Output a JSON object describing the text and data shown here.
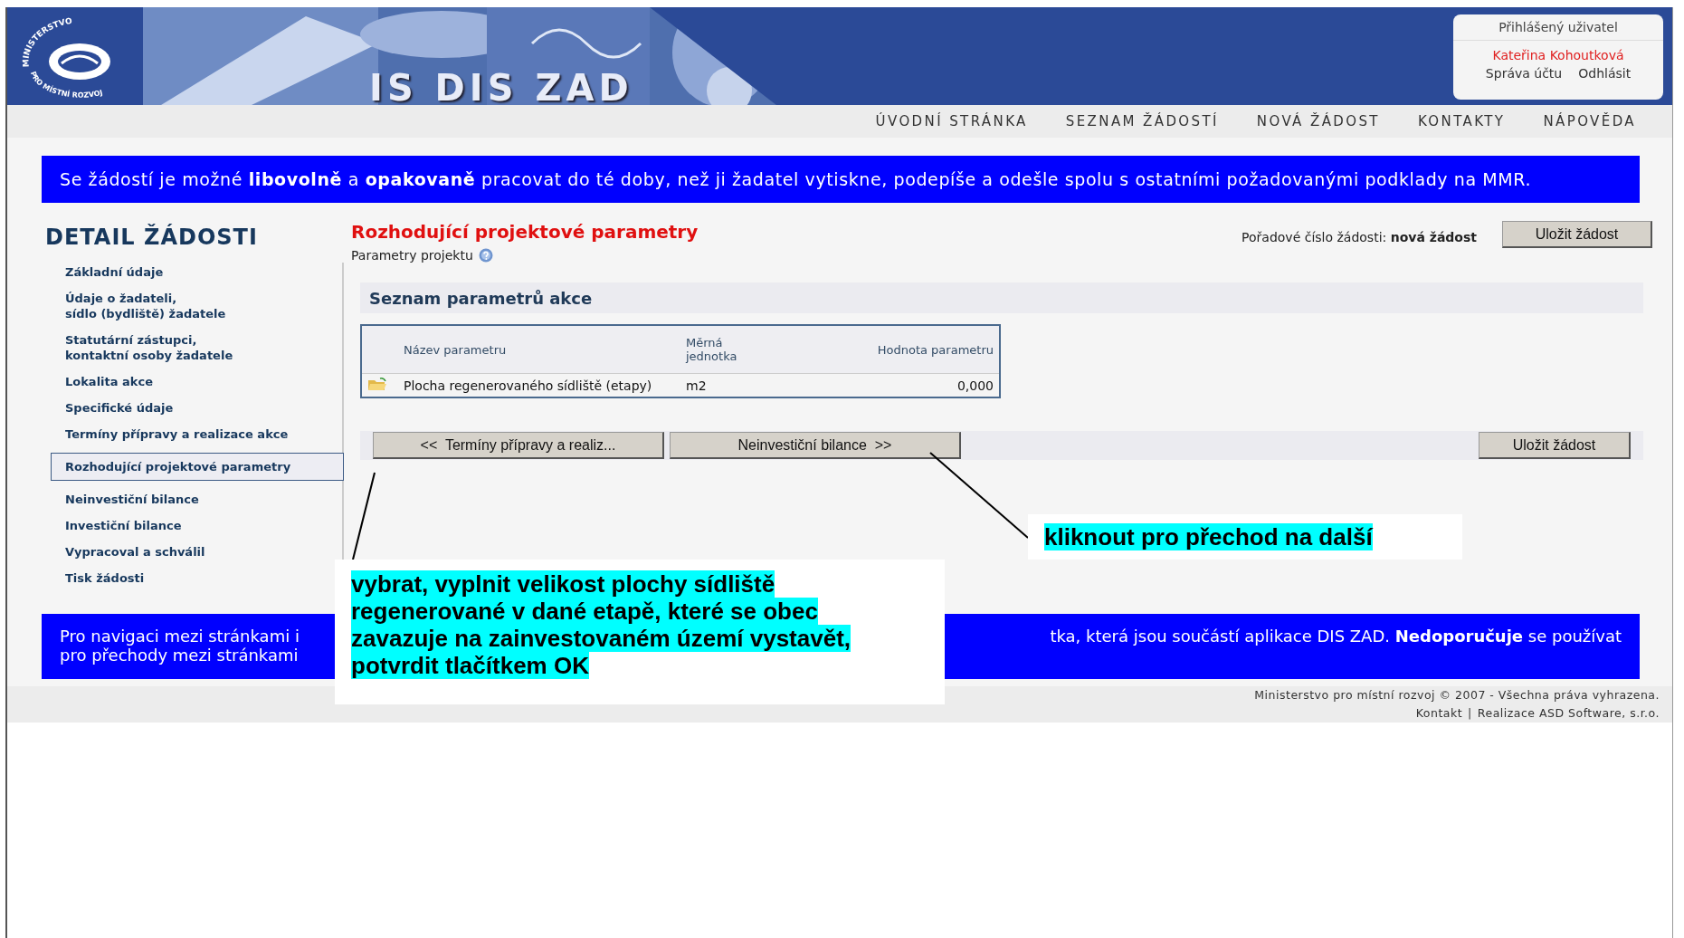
{
  "header": {
    "logo_top": "MINISTERSTVO",
    "logo_bottom": "PRO MÍSTNÍ ROZVOJ",
    "app_title": "IS DIS ZAD",
    "user_box": {
      "heading": "Přihlášený uživatel",
      "name": "Kateřina Kohoutková",
      "links": [
        "Správa účtu",
        "Odhlásit"
      ]
    }
  },
  "nav": [
    "ÚVODNÍ STRÁNKA",
    "SEZNAM ŽÁDOSTÍ",
    "NOVÁ ŽÁDOST",
    "KONTAKTY",
    "NÁPOVĚDA"
  ],
  "notice": "Se žádostí je možné **libovolně** a **opakovaně** pracovat do té doby, než ji žadatel vytiskne, podepíše a odešle spolu s ostatními požadovanými podklady na MMR.",
  "sidebar": {
    "title": "DETAIL ŽÁDOSTI",
    "items": [
      {
        "label": "Základní údaje",
        "selected": false
      },
      {
        "label": "Údaje o žadateli,\nsídlo (bydliště) žadatele",
        "selected": false
      },
      {
        "label": "Statutární zástupci,\nkontaktní osoby žadatele",
        "selected": false
      },
      {
        "label": "Lokalita akce",
        "selected": false
      },
      {
        "label": "Specifické údaje",
        "selected": false
      },
      {
        "label": "Termíny přípravy a realizace akce",
        "selected": false
      },
      {
        "label": "Rozhodující projektové parametry",
        "selected": true
      },
      {
        "label": "Neinvestiční bilance",
        "selected": false
      },
      {
        "label": "Investiční bilance",
        "selected": false
      },
      {
        "label": "Vypracoval a schválil",
        "selected": false
      },
      {
        "label": "Tisk žádosti",
        "selected": false
      }
    ]
  },
  "main": {
    "title": "Rozhodující projektové parametry",
    "subtitle": "Parametry projektu",
    "order_label": "Pořadové číslo žádosti:",
    "order_value": "nová žádost",
    "save_top": "Uložit žádost",
    "section_title": "Seznam parametrů akce",
    "table": {
      "columns": [
        "Název parametru",
        "Měrná jednotka",
        "Hodnota parametru"
      ],
      "rows": [
        {
          "name": "Plocha regenerovaného sídliště (etapy)",
          "unit": "m2",
          "value": "0,000"
        }
      ]
    },
    "buttons": {
      "prev": "<<  Termíny přípravy a realiz...",
      "next": "Neinvestiční bilance  >>",
      "save": "Uložit žádost"
    }
  },
  "bottom_notice": {
    "left_lines": [
      "Pro navigaci mezi stránkami i",
      "pro přechody mezi stránkami"
    ],
    "right_line": "tka, která jsou součástí aplikace DIS ZAD. **Nedoporučuje** se používat"
  },
  "footer": {
    "copyright": "Ministerstvo pro místní rozvoj © 2007 - Všechna práva vyhrazena.",
    "links": [
      "Kontakt",
      "Realizace ASD Software, s.r.o."
    ],
    "separator": "|"
  },
  "callouts": [
    {
      "text": "vybrat, vyplnit velikost plochy sídliště regenerované v dané etapě, které se obec zavazuje na zainvestovaném území vystavět, potvrdit tlačítkem OK"
    },
    {
      "text": "kliknout pro přechod na další"
    }
  ]
}
